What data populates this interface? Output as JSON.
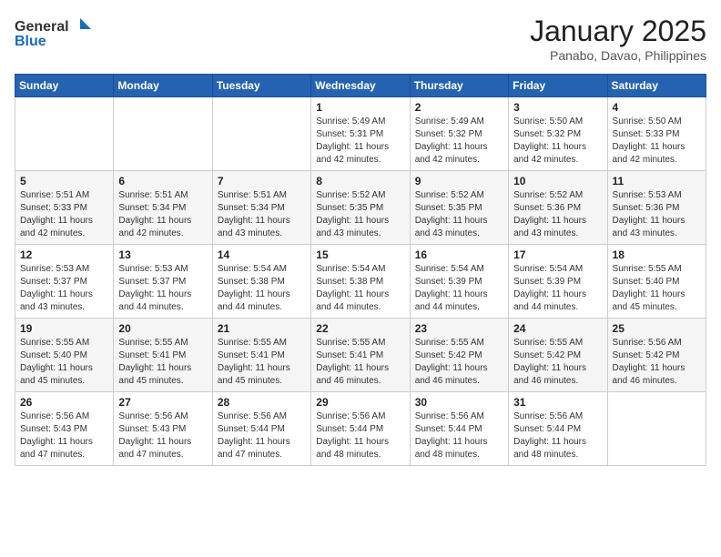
{
  "logo": {
    "general": "General",
    "blue": "Blue"
  },
  "title": "January 2025",
  "subtitle": "Panabo, Davao, Philippines",
  "weekdays": [
    "Sunday",
    "Monday",
    "Tuesday",
    "Wednesday",
    "Thursday",
    "Friday",
    "Saturday"
  ],
  "weeks": [
    [
      {
        "day": "",
        "sunrise": "",
        "sunset": "",
        "daylight": ""
      },
      {
        "day": "",
        "sunrise": "",
        "sunset": "",
        "daylight": ""
      },
      {
        "day": "",
        "sunrise": "",
        "sunset": "",
        "daylight": ""
      },
      {
        "day": "1",
        "sunrise": "Sunrise: 5:49 AM",
        "sunset": "Sunset: 5:31 PM",
        "daylight": "Daylight: 11 hours and 42 minutes."
      },
      {
        "day": "2",
        "sunrise": "Sunrise: 5:49 AM",
        "sunset": "Sunset: 5:32 PM",
        "daylight": "Daylight: 11 hours and 42 minutes."
      },
      {
        "day": "3",
        "sunrise": "Sunrise: 5:50 AM",
        "sunset": "Sunset: 5:32 PM",
        "daylight": "Daylight: 11 hours and 42 minutes."
      },
      {
        "day": "4",
        "sunrise": "Sunrise: 5:50 AM",
        "sunset": "Sunset: 5:33 PM",
        "daylight": "Daylight: 11 hours and 42 minutes."
      }
    ],
    [
      {
        "day": "5",
        "sunrise": "Sunrise: 5:51 AM",
        "sunset": "Sunset: 5:33 PM",
        "daylight": "Daylight: 11 hours and 42 minutes."
      },
      {
        "day": "6",
        "sunrise": "Sunrise: 5:51 AM",
        "sunset": "Sunset: 5:34 PM",
        "daylight": "Daylight: 11 hours and 42 minutes."
      },
      {
        "day": "7",
        "sunrise": "Sunrise: 5:51 AM",
        "sunset": "Sunset: 5:34 PM",
        "daylight": "Daylight: 11 hours and 43 minutes."
      },
      {
        "day": "8",
        "sunrise": "Sunrise: 5:52 AM",
        "sunset": "Sunset: 5:35 PM",
        "daylight": "Daylight: 11 hours and 43 minutes."
      },
      {
        "day": "9",
        "sunrise": "Sunrise: 5:52 AM",
        "sunset": "Sunset: 5:35 PM",
        "daylight": "Daylight: 11 hours and 43 minutes."
      },
      {
        "day": "10",
        "sunrise": "Sunrise: 5:52 AM",
        "sunset": "Sunset: 5:36 PM",
        "daylight": "Daylight: 11 hours and 43 minutes."
      },
      {
        "day": "11",
        "sunrise": "Sunrise: 5:53 AM",
        "sunset": "Sunset: 5:36 PM",
        "daylight": "Daylight: 11 hours and 43 minutes."
      }
    ],
    [
      {
        "day": "12",
        "sunrise": "Sunrise: 5:53 AM",
        "sunset": "Sunset: 5:37 PM",
        "daylight": "Daylight: 11 hours and 43 minutes."
      },
      {
        "day": "13",
        "sunrise": "Sunrise: 5:53 AM",
        "sunset": "Sunset: 5:37 PM",
        "daylight": "Daylight: 11 hours and 44 minutes."
      },
      {
        "day": "14",
        "sunrise": "Sunrise: 5:54 AM",
        "sunset": "Sunset: 5:38 PM",
        "daylight": "Daylight: 11 hours and 44 minutes."
      },
      {
        "day": "15",
        "sunrise": "Sunrise: 5:54 AM",
        "sunset": "Sunset: 5:38 PM",
        "daylight": "Daylight: 11 hours and 44 minutes."
      },
      {
        "day": "16",
        "sunrise": "Sunrise: 5:54 AM",
        "sunset": "Sunset: 5:39 PM",
        "daylight": "Daylight: 11 hours and 44 minutes."
      },
      {
        "day": "17",
        "sunrise": "Sunrise: 5:54 AM",
        "sunset": "Sunset: 5:39 PM",
        "daylight": "Daylight: 11 hours and 44 minutes."
      },
      {
        "day": "18",
        "sunrise": "Sunrise: 5:55 AM",
        "sunset": "Sunset: 5:40 PM",
        "daylight": "Daylight: 11 hours and 45 minutes."
      }
    ],
    [
      {
        "day": "19",
        "sunrise": "Sunrise: 5:55 AM",
        "sunset": "Sunset: 5:40 PM",
        "daylight": "Daylight: 11 hours and 45 minutes."
      },
      {
        "day": "20",
        "sunrise": "Sunrise: 5:55 AM",
        "sunset": "Sunset: 5:41 PM",
        "daylight": "Daylight: 11 hours and 45 minutes."
      },
      {
        "day": "21",
        "sunrise": "Sunrise: 5:55 AM",
        "sunset": "Sunset: 5:41 PM",
        "daylight": "Daylight: 11 hours and 45 minutes."
      },
      {
        "day": "22",
        "sunrise": "Sunrise: 5:55 AM",
        "sunset": "Sunset: 5:41 PM",
        "daylight": "Daylight: 11 hours and 46 minutes."
      },
      {
        "day": "23",
        "sunrise": "Sunrise: 5:55 AM",
        "sunset": "Sunset: 5:42 PM",
        "daylight": "Daylight: 11 hours and 46 minutes."
      },
      {
        "day": "24",
        "sunrise": "Sunrise: 5:55 AM",
        "sunset": "Sunset: 5:42 PM",
        "daylight": "Daylight: 11 hours and 46 minutes."
      },
      {
        "day": "25",
        "sunrise": "Sunrise: 5:56 AM",
        "sunset": "Sunset: 5:42 PM",
        "daylight": "Daylight: 11 hours and 46 minutes."
      }
    ],
    [
      {
        "day": "26",
        "sunrise": "Sunrise: 5:56 AM",
        "sunset": "Sunset: 5:43 PM",
        "daylight": "Daylight: 11 hours and 47 minutes."
      },
      {
        "day": "27",
        "sunrise": "Sunrise: 5:56 AM",
        "sunset": "Sunset: 5:43 PM",
        "daylight": "Daylight: 11 hours and 47 minutes."
      },
      {
        "day": "28",
        "sunrise": "Sunrise: 5:56 AM",
        "sunset": "Sunset: 5:44 PM",
        "daylight": "Daylight: 11 hours and 47 minutes."
      },
      {
        "day": "29",
        "sunrise": "Sunrise: 5:56 AM",
        "sunset": "Sunset: 5:44 PM",
        "daylight": "Daylight: 11 hours and 48 minutes."
      },
      {
        "day": "30",
        "sunrise": "Sunrise: 5:56 AM",
        "sunset": "Sunset: 5:44 PM",
        "daylight": "Daylight: 11 hours and 48 minutes."
      },
      {
        "day": "31",
        "sunrise": "Sunrise: 5:56 AM",
        "sunset": "Sunset: 5:44 PM",
        "daylight": "Daylight: 11 hours and 48 minutes."
      },
      {
        "day": "",
        "sunrise": "",
        "sunset": "",
        "daylight": ""
      }
    ]
  ]
}
